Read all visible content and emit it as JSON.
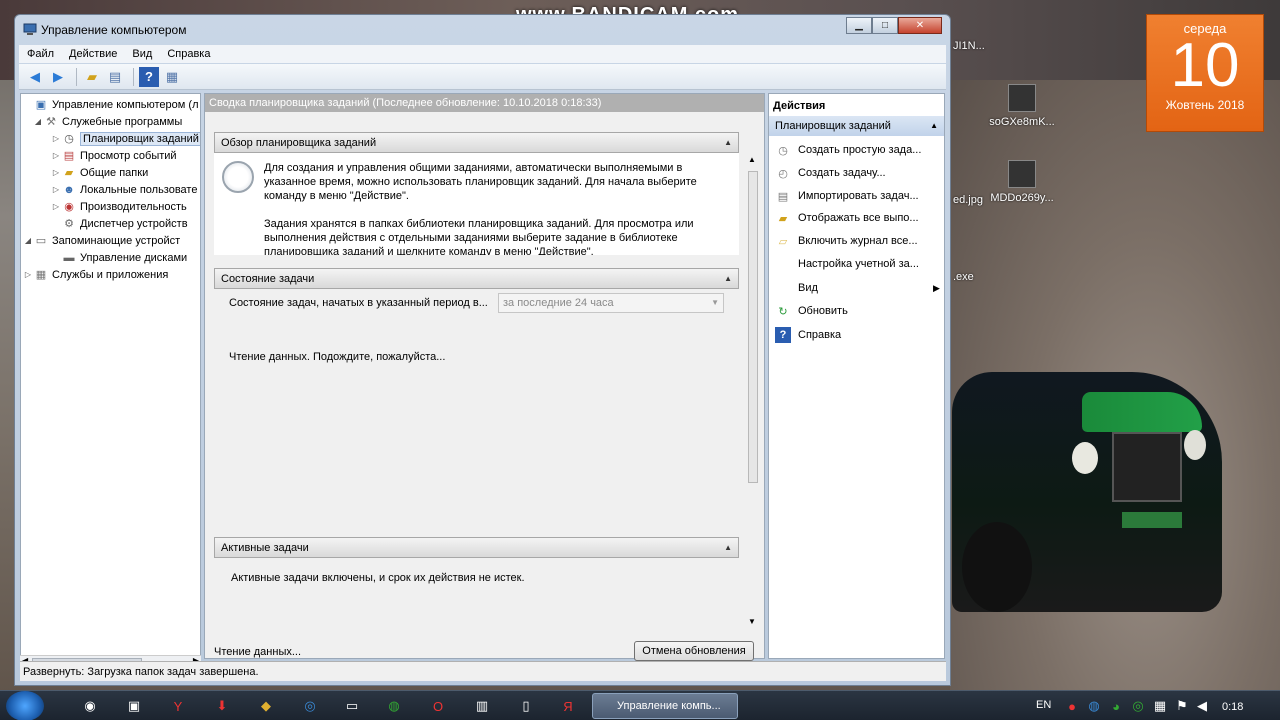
{
  "watermark": "www.BANDICAM.com",
  "calendar": {
    "weekday": "середа",
    "day": "10",
    "month": "Жовтень 2018"
  },
  "desktop": {
    "icons": [
      {
        "label": "soGXe8mK..."
      },
      {
        "label": "MDDo269y..."
      }
    ],
    "edge_fragments": [
      "JI1N...",
      "ed.jpg",
      ".exe"
    ]
  },
  "window": {
    "title": "Управление компьютером",
    "buttons": {
      "minimize": "▁",
      "maximize": "□",
      "close": "✕"
    },
    "menu": [
      "Файл",
      "Действие",
      "Вид",
      "Справка"
    ],
    "toolbar_icons": [
      "back-arrow-icon",
      "forward-arrow-icon",
      "up-folder-icon",
      "show-hide-tree-icon",
      "help-icon",
      "properties-icon"
    ]
  },
  "tree": {
    "items": [
      {
        "label": "Управление компьютером (л",
        "icon": "computer-management-icon",
        "expander": ""
      },
      {
        "label": "Служебные программы",
        "icon": "tools-icon",
        "expander": "◢"
      },
      {
        "label": "Планировщик заданий",
        "icon": "clock-icon",
        "expander": "▷",
        "selected": true
      },
      {
        "label": "Просмотр событий",
        "icon": "event-viewer-icon",
        "expander": "▷"
      },
      {
        "label": "Общие папки",
        "icon": "shared-folders-icon",
        "expander": "▷"
      },
      {
        "label": "Локальные пользовате",
        "icon": "users-icon",
        "expander": "▷"
      },
      {
        "label": "Производительность",
        "icon": "performance-icon",
        "expander": "▷"
      },
      {
        "label": "Диспетчер устройств",
        "icon": "device-manager-icon",
        "expander": ""
      },
      {
        "label": "Запоминающие устройст",
        "icon": "storage-icon",
        "expander": "◢"
      },
      {
        "label": "Управление дисками",
        "icon": "disk-icon",
        "expander": ""
      },
      {
        "label": "Службы и приложения",
        "icon": "services-icon",
        "expander": "▷"
      }
    ]
  },
  "center": {
    "header": "Сводка планировщика заданий (Последнее обновление: 10.10.2018 0:18:33)",
    "overview": {
      "title": "Обзор планировщика заданий",
      "text1": "Для создания и управления общими заданиями, автоматически выполняемыми в указанное время, можно использовать планировщик заданий. Для начала выберите команду в меню \"Действие\".",
      "text2": "Задания хранятся в папках библиотеки планировщика заданий. Для просмотра или выполнения действия с отдельными заданиями выберите задание в библиотеке планировщика заданий и щелкните команду в меню \"Действие\"."
    },
    "status": {
      "title": "Состояние задачи",
      "label": "Состояние задач, начатых в указанный период в...",
      "combo": "за последние 24 часа",
      "loading": "Чтение данных. Подождите, пожалуйста..."
    },
    "active": {
      "title": "Активные задачи",
      "text": "Активные задачи включены, и срок их действия не истек."
    },
    "footer_status": "Чтение данных...",
    "cancel_button": "Отмена обновления"
  },
  "actions": {
    "title": "Действия",
    "section": "Планировщик заданий",
    "items": [
      {
        "label": "Создать простую зада...",
        "icon": "create-basic-task-icon"
      },
      {
        "label": "Создать задачу...",
        "icon": "create-task-icon"
      },
      {
        "label": "Импортировать задач...",
        "icon": "import-icon"
      },
      {
        "label": "Отображать все выпо...",
        "icon": "folder-icon"
      },
      {
        "label": "Включить журнал все...",
        "icon": "folder-open-icon"
      },
      {
        "label": "Настройка учетной за...",
        "icon": ""
      },
      {
        "label": "Вид",
        "icon": "",
        "submenu": true
      },
      {
        "label": "Обновить",
        "icon": "refresh-icon"
      },
      {
        "label": "Справка",
        "icon": "help-icon"
      }
    ]
  },
  "statusbar": "Развернуть:  Загрузка папок задач завершена.",
  "taskbar": {
    "active_task": "Управление компь...",
    "language": "EN",
    "time": "0:18"
  }
}
